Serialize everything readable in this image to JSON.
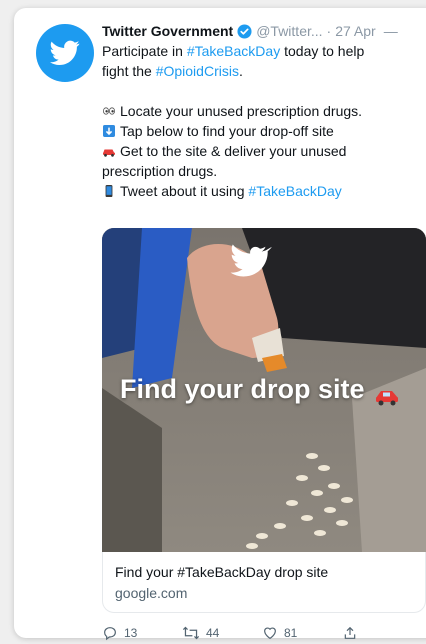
{
  "tweet": {
    "author_name": "Twitter Government",
    "handle": "@Twitter...",
    "separator": "·",
    "date": "27 Apr",
    "more_label": "—",
    "line1_prefix": "Participate in ",
    "line1_tag": "#TakeBackDay",
    "line1_suffix": " today to help",
    "line2_prefix": "fight the ",
    "line2_tag": "#OpioidCrisis",
    "line2_suffix": ".",
    "bullet1": "Locate your unused prescription drugs.",
    "bullet2": "Tap below to find your drop-off site",
    "bullet3a": "Get to the site & deliver your unused",
    "bullet3b": "prescription drugs.",
    "bullet4_prefix": "Tweet about it using ",
    "bullet4_tag": "#TakeBackDay"
  },
  "media": {
    "title": "Find your drop site"
  },
  "link_card": {
    "title": "Find your #TakeBackDay drop site",
    "domain": "google.com"
  },
  "actions": {
    "replies": "13",
    "retweets": "44",
    "likes": "81"
  },
  "colors": {
    "accent": "#1d9bf0",
    "text": "#0f1419",
    "muted": "#536471"
  }
}
